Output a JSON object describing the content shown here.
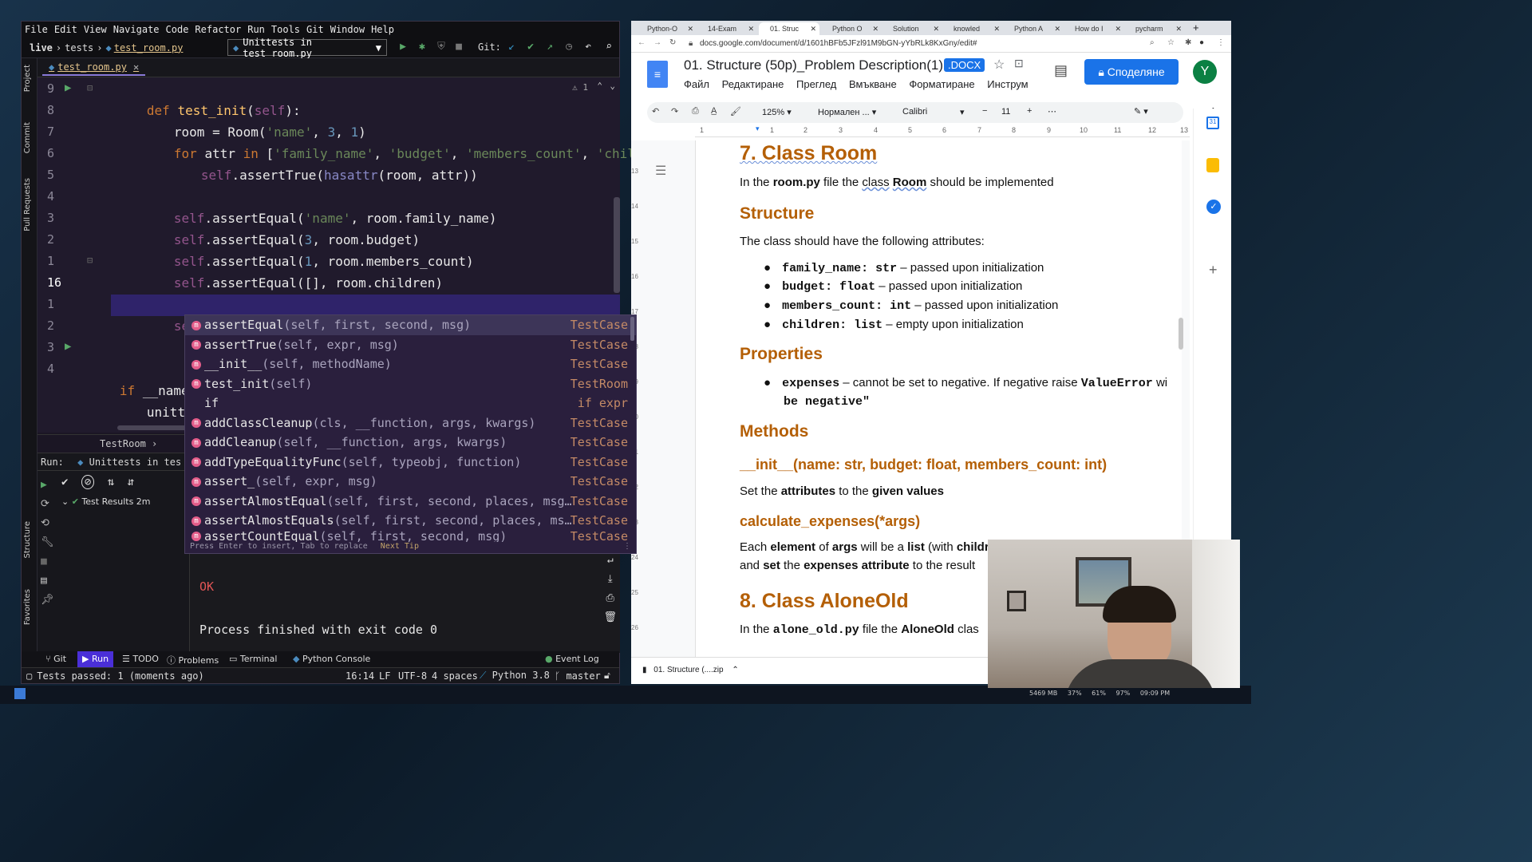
{
  "ide": {
    "menu": [
      "File",
      "Edit",
      "View",
      "Navigate",
      "Code",
      "Refactor",
      "Run",
      "Tools",
      "Git",
      "Window",
      "Help"
    ],
    "breadcrumb": {
      "project": "live",
      "folder": "tests",
      "file": "test_room.py"
    },
    "run_config": "Unittests in test_room.py",
    "git_label": "Git:",
    "left_tools": [
      "Project",
      "Commit",
      "Pull Requests",
      "Structure",
      "Favorites"
    ],
    "tab": "test_room.py",
    "warning_count": "1",
    "line_numbers": [
      "9",
      "8",
      "7",
      "6",
      "5",
      "4",
      "3",
      "2",
      "1",
      "16",
      "1",
      "2",
      "3",
      "4"
    ],
    "code": {
      "l9": [
        "def ",
        "test_init",
        "(",
        "self",
        "):"
      ],
      "l8": [
        "room = Room(",
        "'name'",
        ", ",
        "3",
        ", ",
        "1",
        ")"
      ],
      "l7": [
        "for ",
        "attr ",
        "in ",
        "[",
        "'family_name'",
        ", ",
        "'budget'",
        ", ",
        "'members_count'",
        ", ",
        "'children'",
        "]:"
      ],
      "l6": [
        "self",
        ".assertTrue(",
        "hasattr",
        "(room, attr))"
      ],
      "l4": [
        "self",
        ".assertEqual(",
        "'name'",
        ", room.family_name)"
      ],
      "l3": [
        "self",
        ".assertEqual(",
        "3",
        ", room.budget)"
      ],
      "l2": [
        "self",
        ".assertEqual(",
        "1",
        ", room.members_count)"
      ],
      "l1": [
        "self",
        ".assertEqual([], room.children)"
      ],
      "l16": [
        "self",
        "."
      ],
      "main_if": [
        "if ",
        "__name_"
      ],
      "main_call": "unitte"
    },
    "completion": [
      {
        "name": "assertEqual",
        "sig": "(self, first, second, msg)",
        "type": "TestCase"
      },
      {
        "name": "assertTrue",
        "sig": "(self, expr, msg)",
        "type": "TestCase"
      },
      {
        "name": "__init__",
        "sig": "(self, methodName)",
        "type": "TestCase"
      },
      {
        "name": "test_init",
        "sig": "(self)",
        "type": "TestRoom"
      },
      {
        "name": "if",
        "sig": "",
        "type": "if expr"
      },
      {
        "name": "addClassCleanup",
        "sig": "(cls, __function, args, kwargs)",
        "type": "TestCase"
      },
      {
        "name": "addCleanup",
        "sig": "(self, __function, args, kwargs)",
        "type": "TestCase"
      },
      {
        "name": "addTypeEqualityFunc",
        "sig": "(self, typeobj, function)",
        "type": "TestCase"
      },
      {
        "name": "assert_",
        "sig": "(self, expr, msg)",
        "type": "TestCase"
      },
      {
        "name": "assertAlmostEqual",
        "sig": "(self, first, second, places, msg…",
        "type": "TestCase"
      },
      {
        "name": "assertAlmostEquals",
        "sig": "(self, first, second, places, ms…",
        "type": "TestCase"
      },
      {
        "name": "assertCountEqual",
        "sig": "(self, first, second, msg)",
        "type": "TestCase"
      }
    ],
    "completion_footer": {
      "hint": "Press Enter to insert, Tab to replace",
      "tip": "Next Tip"
    },
    "breadcrumb_class": "TestRoom",
    "run": {
      "label": "Run:",
      "config": "Unittests in tes",
      "results": "Test Results 2m",
      "ok": "OK",
      "exit": "Process finished with exit code 0"
    },
    "bottom_tools": [
      "Git",
      "Run",
      "TODO",
      "Problems",
      "Terminal",
      "Python Console",
      "Event Log"
    ],
    "status": {
      "msg": "Tests passed: 1 (moments ago)",
      "pos": "16:14",
      "lf": "LF",
      "enc": "UTF-8",
      "indent": "4 spaces",
      "py": "Python 3.8",
      "branch": "master"
    }
  },
  "browser": {
    "tabs": [
      "Python-O",
      "14-Exam",
      "01. Struc",
      "Python O",
      "Solution",
      "knowled",
      "Python A",
      "How do I",
      "pycharm"
    ],
    "url": "docs.google.com/document/d/1601hBFb5JFzl91M9bGN-yYbRLk8KxGny/edit#",
    "doc_title": "01. Structure (50p)_Problem Description(1)",
    "doc_badge": ".DOCX",
    "doc_menu": [
      "Файл",
      "Редактиране",
      "Преглед",
      "Вмъкване",
      "Форматиране",
      "Инструм"
    ],
    "share": "Споделяне",
    "avatar": "Y",
    "toolbar": {
      "zoom": "125%",
      "style": "Нормален ...",
      "font": "Calibri",
      "size": "11"
    },
    "ruler": [
      "1",
      "2",
      "3",
      "4",
      "5",
      "6",
      "7",
      "8",
      "9",
      "10",
      "11",
      "12",
      "13"
    ],
    "vruler": [
      "13",
      "14",
      "15",
      "16",
      "17",
      "18",
      "19",
      "20",
      "21",
      "22",
      "23",
      "24",
      "25",
      "26"
    ],
    "doc": {
      "h_class_room": "7. Class Room",
      "intro": [
        "In the ",
        "room.py",
        " file the ",
        "class",
        " ",
        "Room",
        " should be implemented"
      ],
      "h_structure": "Structure",
      "structure_text": "The class should have the following attributes:",
      "attrs": [
        {
          "name": "family_name: ",
          "type": "str",
          "desc": " – passed upon initialization"
        },
        {
          "name": "budget: ",
          "type": "float",
          "desc": " – passed upon initialization"
        },
        {
          "name": "members_count: ",
          "type": "int",
          "desc": " – passed upon initialization"
        },
        {
          "name": "children: ",
          "type": "list",
          "desc": " – empty upon initialization"
        }
      ],
      "h_properties": "Properties",
      "prop": {
        "name": "expenses",
        "text": " – cannot be set to negative. If negative raise ",
        "err": "ValueError",
        "tail": " wi",
        "line2": "be negative\""
      },
      "h_methods": "Methods",
      "h_init": "__init__(name: str, budget: float, members_count: int)",
      "init_text": [
        "Set the ",
        "attributes",
        " to the ",
        "given values"
      ],
      "h_calc": "calculate_expenses(*args)",
      "calc_text1": [
        "Each ",
        "element",
        " of ",
        "args",
        " will be a ",
        "list",
        " (with ",
        "childr"
      ],
      "calc_text2": [
        "and ",
        "set",
        " the ",
        "expenses attribute",
        " to the result"
      ],
      "h_alone": "8. Class AloneOld",
      "alone_text": [
        "In the ",
        "alone_old.py",
        " file the ",
        "AloneOld",
        " clas"
      ]
    },
    "download": "01. Structure (....zip"
  },
  "taskbar": {
    "mem": "5469 MB",
    "p1": "37%",
    "p2": "61%",
    "p3": "97%",
    "time": "09:09 PM"
  }
}
